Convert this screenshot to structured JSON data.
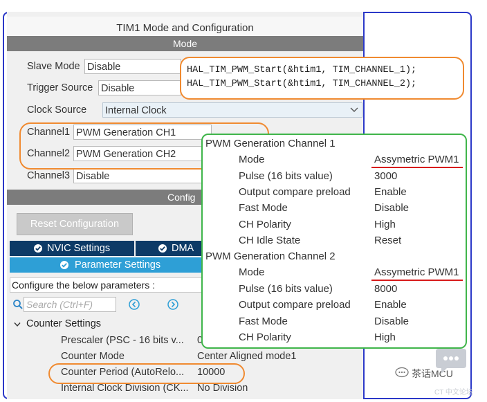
{
  "window": {
    "title": "TIM1 Mode and Configuration"
  },
  "mode_section": {
    "header": "Mode",
    "rows": [
      {
        "label": "Slave Mode",
        "value": "Disable"
      },
      {
        "label": "Trigger Source",
        "value": "Disable"
      },
      {
        "label": "Clock Source",
        "value": "Internal Clock"
      },
      {
        "label": "Channel1",
        "value": "PWM Generation CH1"
      },
      {
        "label": "Channel2",
        "value": "PWM Generation CH2"
      },
      {
        "label": "Channel3",
        "value": "Disable"
      }
    ]
  },
  "config_section": {
    "header": "Config",
    "reset_button": "Reset Configuration",
    "tabs": {
      "nvic": "NVIC Settings",
      "dma": "DMA",
      "params": "Parameter Settings"
    },
    "hint": "Configure the below parameters :",
    "search_placeholder": "Search (Ctrl+F)",
    "counter_group": "Counter Settings",
    "params": [
      {
        "name": "Prescaler (PSC - 16 bits v...",
        "value": "0"
      },
      {
        "name": "Counter Mode",
        "value": "Center Aligned mode1"
      },
      {
        "name": "Counter Period (AutoRelo...",
        "value": "10000"
      },
      {
        "name": "Internal Clock Division (CK...",
        "value": "No Division"
      }
    ]
  },
  "code_note": {
    "line1": "HAL_TIM_PWM_Start(&htim1,  TIM_CHANNEL_1);",
    "line2": "HAL_TIM_PWM_Start(&htim1,  TIM_CHANNEL_2);"
  },
  "pwm_channels": [
    {
      "title": "PWM Generation Channel 1",
      "rows": [
        {
          "name": "Mode",
          "value": "Assymetric PWM1"
        },
        {
          "name": "Pulse (16 bits value)",
          "value": "3000"
        },
        {
          "name": "Output compare preload",
          "value": "Enable"
        },
        {
          "name": "Fast Mode",
          "value": "Disable"
        },
        {
          "name": "CH Polarity",
          "value": "High"
        },
        {
          "name": "CH Idle State",
          "value": "Reset"
        }
      ]
    },
    {
      "title": "PWM Generation Channel 2",
      "rows": [
        {
          "name": "Mode",
          "value": "Assymetric PWM1"
        },
        {
          "name": "Pulse (16 bits value)",
          "value": "8000"
        },
        {
          "name": "Output compare preload",
          "value": "Enable"
        },
        {
          "name": "Fast Mode",
          "value": "Disable"
        },
        {
          "name": "CH Polarity",
          "value": "High"
        }
      ]
    }
  ],
  "watermark": {
    "brand": "茶话MCU",
    "site": "CT 中文论坛"
  },
  "colors": {
    "frame_blue": "#2b38c8",
    "orange": "#f08a30",
    "green": "#3fb54a",
    "red": "#d81a1a",
    "tab_dark": "#0d3a66",
    "tab_light": "#2e9fd6"
  },
  "icons": [
    "check-circle-icon",
    "search-icon",
    "arrow-left-icon",
    "arrow-right-icon",
    "chevron-down-icon",
    "expand-chevron-icon",
    "chat-logo-icon"
  ]
}
